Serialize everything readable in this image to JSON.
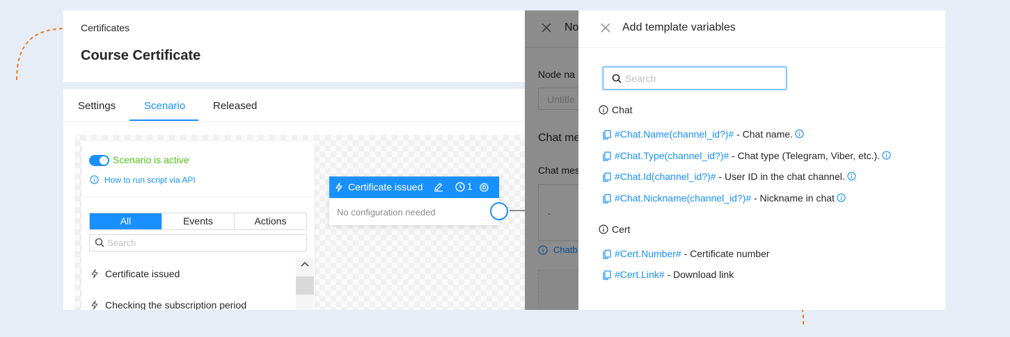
{
  "colors": {
    "accent": "#1890ff",
    "active": "#52c41a",
    "annotation": "#e67e22",
    "background": "#e6edf6"
  },
  "header": {
    "breadcrumb": "Certificates",
    "title": "Course Certificate"
  },
  "tabs": [
    {
      "label": "Settings",
      "active": false
    },
    {
      "label": "Scenario",
      "active": true
    },
    {
      "label": "Released",
      "active": false
    }
  ],
  "left_panel": {
    "status_label": "Scenario is active",
    "toggle_on": true,
    "api_link": "How to run script via API",
    "filters": [
      "All",
      "Events",
      "Actions"
    ],
    "active_filter": "All",
    "search_placeholder": "Search",
    "items": [
      {
        "label": "Certificate issued",
        "icon": "bolt-icon"
      },
      {
        "label": "Checking the subscription period",
        "icon": "bolt-icon"
      }
    ]
  },
  "node": {
    "title": "Certificate issued",
    "count": "1",
    "body": "No configuration needed"
  },
  "node_drawer": {
    "title": "No",
    "node_name_label": "Node na",
    "node_name_placeholder": "Untitle",
    "chat_message_heading": "Chat me",
    "chat_message_label": "Chat mes",
    "textarea_value": ".",
    "chatbot_link": "Chatb"
  },
  "variables_drawer": {
    "title": "Add template variables",
    "search_placeholder": "Search",
    "groups": [
      {
        "name": "Chat",
        "items": [
          {
            "variable": "#Chat.Name(channel_id?)#",
            "description": " - Chat name.",
            "info": true
          },
          {
            "variable": "#Chat.Type(channel_id?)#",
            "description": " - Chat type (Telegram, Viber, etc.).",
            "info": true
          },
          {
            "variable": "#Chat.Id(channel_id?)#",
            "description": " - User ID in the chat channel.",
            "info": true
          },
          {
            "variable": "#Chat.Nickname(channel_id?)#",
            "description": " - Nickname in chat",
            "info": true
          }
        ]
      },
      {
        "name": "Cert",
        "items": [
          {
            "variable": "#Cert.Number#",
            "description": " - Certificate number",
            "info": false
          },
          {
            "variable": "#Cert.Link#",
            "description": " - Download link",
            "info": false
          }
        ]
      }
    ]
  }
}
